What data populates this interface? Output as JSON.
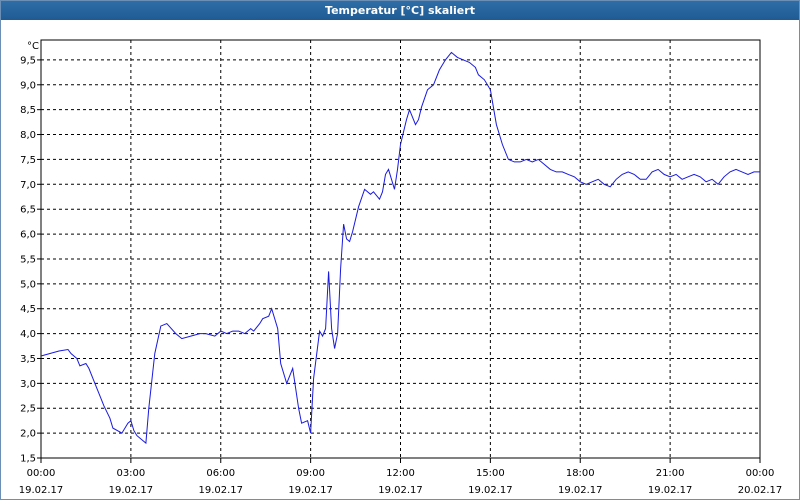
{
  "window": {
    "title": "Temperatur [°C] skaliert"
  },
  "chart_data": {
    "type": "line",
    "title": "Temperatur [°C] skaliert",
    "ylabel": "°C",
    "xlabel": "",
    "ylim": [
      1.5,
      9.9
    ],
    "yticks": [
      1.5,
      2.0,
      2.5,
      3.0,
      3.5,
      4.0,
      4.5,
      5.0,
      5.5,
      6.0,
      6.5,
      7.0,
      7.5,
      8.0,
      8.5,
      9.0,
      9.5
    ],
    "ytick_labels": [
      "1,5",
      "2,0",
      "2,5",
      "3,0",
      "3,5",
      "4,0",
      "4,5",
      "5,0",
      "5,5",
      "6,0",
      "6,5",
      "7,0",
      "7,5",
      "8,0",
      "8,5",
      "9,0",
      "9,5"
    ],
    "xlim": [
      0,
      24
    ],
    "xticks": [
      {
        "hour": 0,
        "time": "00:00",
        "date": "19.02.17"
      },
      {
        "hour": 3,
        "time": "03:00",
        "date": "19.02.17"
      },
      {
        "hour": 6,
        "time": "06:00",
        "date": "19.02.17"
      },
      {
        "hour": 9,
        "time": "09:00",
        "date": "19.02.17"
      },
      {
        "hour": 12,
        "time": "12:00",
        "date": "19.02.17"
      },
      {
        "hour": 15,
        "time": "15:00",
        "date": "19.02.17"
      },
      {
        "hour": 18,
        "time": "18:00",
        "date": "19.02.17"
      },
      {
        "hour": 21,
        "time": "21:00",
        "date": "19.02.17"
      },
      {
        "hour": 24,
        "time": "00:00",
        "date": "20.02.17"
      }
    ],
    "grid": true,
    "line_color": "#1a1adf",
    "series": [
      {
        "x": [
          0,
          0.3,
          0.6,
          0.9,
          1.0,
          1.2,
          1.3,
          1.5,
          1.6,
          1.8,
          2.0,
          2.1,
          2.3,
          2.4,
          2.7,
          2.9,
          3.0,
          3.1,
          3.2,
          3.4,
          3.5,
          3.6,
          3.8,
          4.0,
          4.2,
          4.5,
          4.7,
          5.0,
          5.3,
          5.5,
          5.8,
          6.0,
          6.2,
          6.4,
          6.6,
          6.8,
          7.0,
          7.1,
          7.3,
          7.4,
          7.6,
          7.7,
          7.9,
          8.0,
          8.2,
          8.4,
          8.6,
          8.7,
          8.9,
          9.0,
          9.1,
          9.3,
          9.4,
          9.5,
          9.6,
          9.7,
          9.8,
          9.9,
          10.0,
          10.1,
          10.2,
          10.3,
          10.4,
          10.6,
          10.8,
          11.0,
          11.1,
          11.3,
          11.4,
          11.5,
          11.6,
          11.8,
          11.9,
          12.0,
          12.2,
          12.3,
          12.5,
          12.6,
          12.7,
          12.9,
          13.1,
          13.3,
          13.5,
          13.7,
          13.9,
          14.1,
          14.3,
          14.5,
          14.6,
          14.8,
          15.0,
          15.2,
          15.4,
          15.6,
          15.8,
          16.0,
          16.2,
          16.4,
          16.6,
          16.8,
          17.0,
          17.2,
          17.4,
          17.6,
          17.8,
          18.0,
          18.2,
          18.4,
          18.6,
          18.8,
          19.0,
          19.2,
          19.4,
          19.6,
          19.8,
          20.0,
          20.2,
          20.4,
          20.6,
          20.8,
          21.0,
          21.2,
          21.4,
          21.6,
          21.8,
          22.0,
          22.2,
          22.4,
          22.6,
          22.8,
          23.0,
          23.2,
          23.4,
          23.6,
          23.8,
          24.0
        ],
        "y": [
          3.55,
          3.6,
          3.65,
          3.68,
          3.6,
          3.5,
          3.35,
          3.4,
          3.3,
          3.0,
          2.7,
          2.55,
          2.3,
          2.1,
          2.0,
          2.2,
          2.25,
          2.05,
          1.95,
          1.85,
          1.8,
          2.5,
          3.6,
          4.15,
          4.2,
          4.0,
          3.9,
          3.95,
          4.0,
          4.0,
          3.95,
          4.05,
          4.0,
          4.05,
          4.05,
          4.0,
          4.1,
          4.05,
          4.2,
          4.3,
          4.35,
          4.5,
          4.1,
          3.4,
          3.0,
          3.3,
          2.5,
          2.2,
          2.25,
          2.0,
          3.1,
          4.05,
          3.95,
          4.1,
          5.25,
          4.1,
          3.7,
          4.0,
          5.3,
          6.2,
          5.9,
          5.85,
          6.05,
          6.55,
          6.9,
          6.8,
          6.85,
          6.7,
          6.85,
          7.2,
          7.3,
          6.9,
          7.3,
          7.8,
          8.3,
          8.5,
          8.2,
          8.3,
          8.55,
          8.9,
          9.0,
          9.3,
          9.5,
          9.65,
          9.55,
          9.5,
          9.45,
          9.35,
          9.2,
          9.1,
          8.9,
          8.2,
          7.8,
          7.5,
          7.45,
          7.45,
          7.5,
          7.45,
          7.5,
          7.4,
          7.3,
          7.25,
          7.25,
          7.2,
          7.15,
          7.05,
          7.0,
          7.05,
          7.1,
          7.0,
          6.95,
          7.1,
          7.2,
          7.25,
          7.2,
          7.1,
          7.1,
          7.25,
          7.3,
          7.2,
          7.15,
          7.2,
          7.1,
          7.15,
          7.2,
          7.15,
          7.05,
          7.1,
          7.0,
          7.15,
          7.25,
          7.3,
          7.25,
          7.2,
          7.25,
          7.25
        ]
      }
    ]
  }
}
